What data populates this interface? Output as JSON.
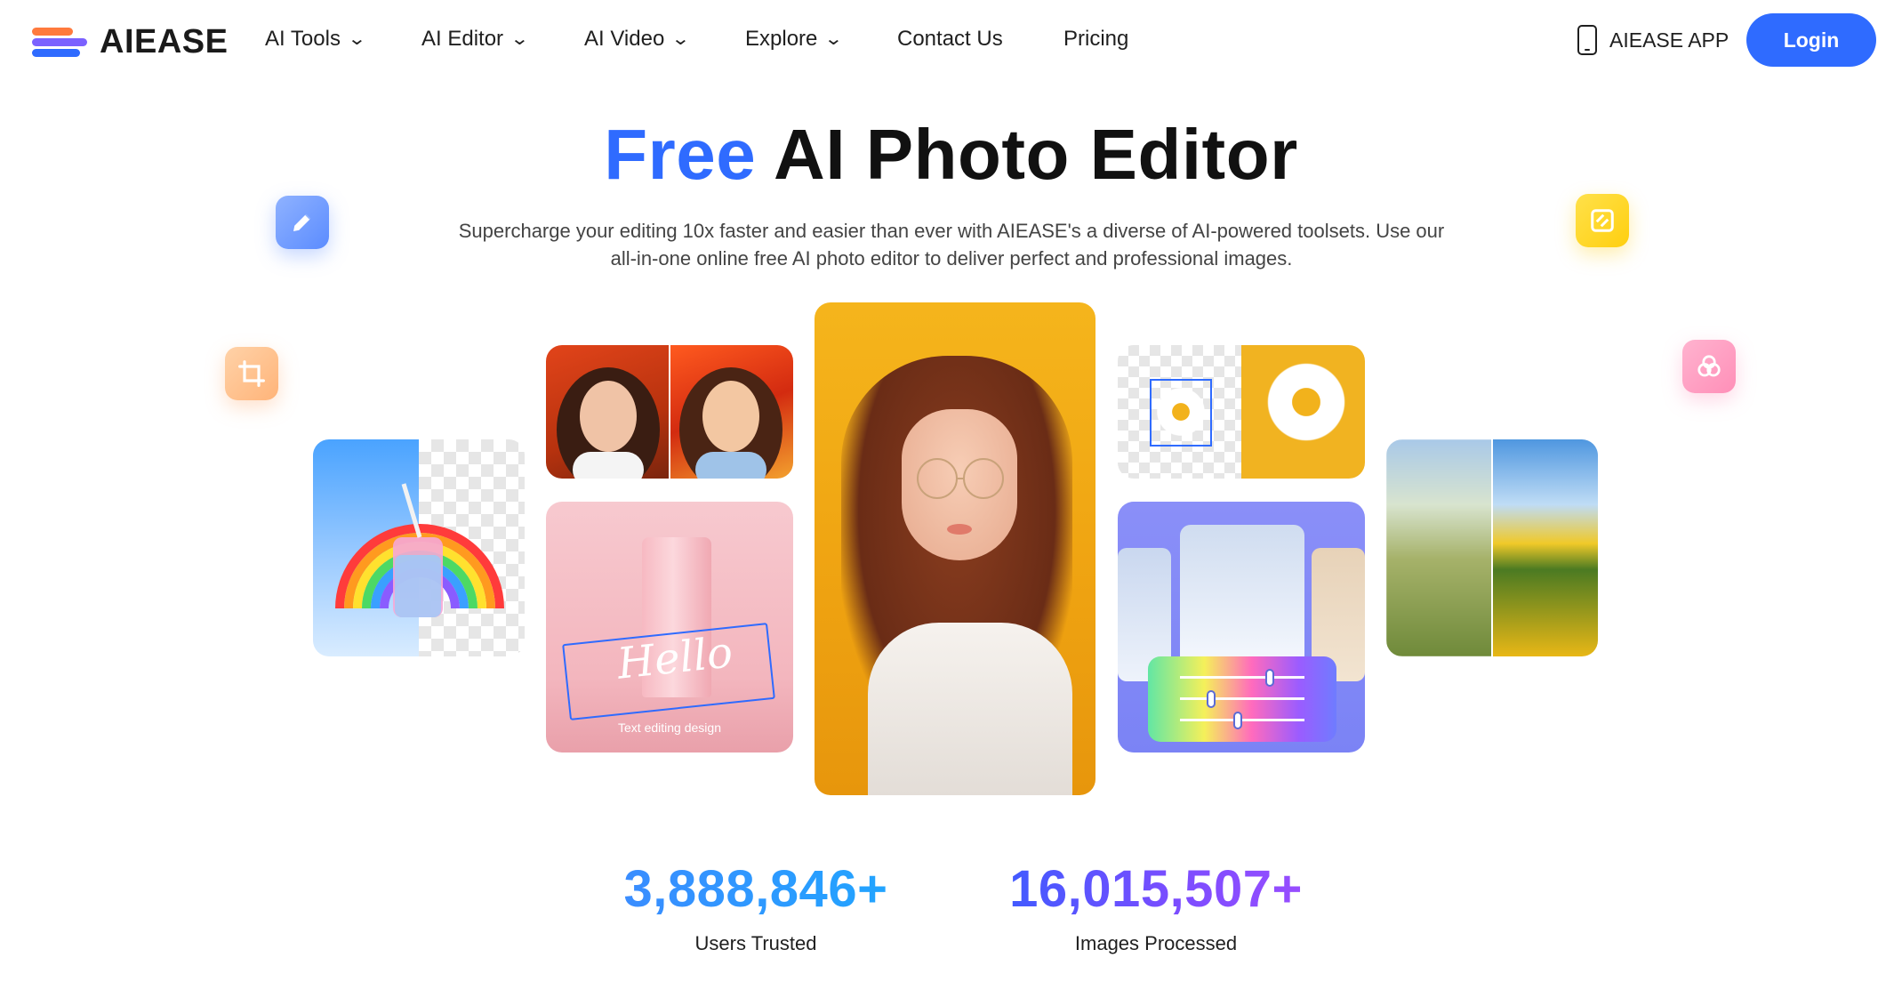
{
  "brand": {
    "name": "AIEASE"
  },
  "nav": {
    "items": [
      {
        "label": "AI Tools",
        "has_dropdown": true
      },
      {
        "label": "AI Editor",
        "has_dropdown": true
      },
      {
        "label": "AI Video",
        "has_dropdown": true
      },
      {
        "label": "Explore",
        "has_dropdown": true
      },
      {
        "label": "Contact Us",
        "has_dropdown": false
      },
      {
        "label": "Pricing",
        "has_dropdown": false
      }
    ],
    "app_label": "AIEASE APP",
    "login_label": "Login"
  },
  "hero": {
    "title_accent": "Free",
    "title_rest": "AI Photo Editor",
    "subtitle_line1": "Supercharge your editing 10x faster and easier than ever with AIEASE's a diverse of AI-powered toolsets. Use our",
    "subtitle_line2": "all-in-one online free AI photo editor to deliver perfect and professional images."
  },
  "showcase": {
    "hello_text": "Hello",
    "text_edit_caption": "Text editing design"
  },
  "stats": {
    "users_count": "3,888,846+",
    "users_label": "Users Trusted",
    "images_count": "16,015,507+",
    "images_label": "Images Processed"
  },
  "colors": {
    "accent": "#2f6bff",
    "users_stat": "#2f8fff",
    "images_stat": "#6a4dff"
  },
  "icons": [
    "pencil-icon",
    "crop-icon",
    "frame-icon",
    "circles-icon",
    "phone-icon",
    "chevron-down-icon"
  ]
}
